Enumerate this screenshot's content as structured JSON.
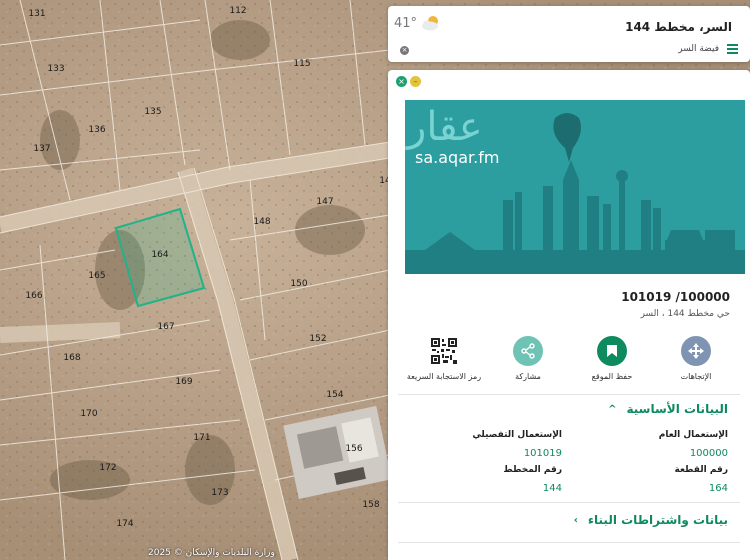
{
  "map": {
    "parcels": [
      {
        "id": "131"
      },
      {
        "id": "112"
      },
      {
        "id": "133"
      },
      {
        "id": "115"
      },
      {
        "id": "135"
      },
      {
        "id": "136"
      },
      {
        "id": "137"
      },
      {
        "id": "14"
      },
      {
        "id": "147"
      },
      {
        "id": "148"
      },
      {
        "id": "164"
      },
      {
        "id": "165"
      },
      {
        "id": "166"
      },
      {
        "id": "150"
      },
      {
        "id": "167"
      },
      {
        "id": "152"
      },
      {
        "id": "168"
      },
      {
        "id": "169"
      },
      {
        "id": "154"
      },
      {
        "id": "170"
      },
      {
        "id": "171"
      },
      {
        "id": "156"
      },
      {
        "id": "172"
      },
      {
        "id": "173"
      },
      {
        "id": "158"
      },
      {
        "id": "174"
      }
    ],
    "selected_parcel": "164",
    "highlight_color": "#1fb389",
    "copyright": "وزارة البلديات والإسكان © 2025"
  },
  "place": {
    "title": "السر، مخطط 144",
    "subtitle": "فيضة السر",
    "temperature": "41°",
    "weather_icon": "partly-cloudy-icon"
  },
  "banner": {
    "logo": "عقار",
    "url": "sa.aqar.fm",
    "bg_color": "#2c9ea0"
  },
  "ad": {
    "number": "101019 /100000",
    "location": "حي مخطط 144 ، السر"
  },
  "actions": [
    {
      "label": "الإتجاهات",
      "icon": "directions-icon"
    },
    {
      "label": "حفظ الموقع",
      "icon": "bookmark-icon"
    },
    {
      "label": "مشاركة",
      "icon": "share-icon"
    },
    {
      "label": "رمز الاستجابة السريعة",
      "icon": "qr-code-icon"
    }
  ],
  "basic_info": {
    "title": "البيانات الأساسية",
    "fields": {
      "general_use_label": "الإستعمال العام",
      "general_use_value": "100000",
      "detailed_use_label": "الإستعمال التفصيلي",
      "detailed_use_value": "101019",
      "parcel_no_label": "رقم القطعة",
      "parcel_no_value": "164",
      "plan_no_label": "رقم المخطط",
      "plan_no_value": "144"
    }
  },
  "building": {
    "title": "بيانات واشتراطات البناء"
  },
  "colors": {
    "accent": "#0d8a5e",
    "action_circle": "#6fc3b5",
    "action_circle_active": "#0d8a5e"
  }
}
